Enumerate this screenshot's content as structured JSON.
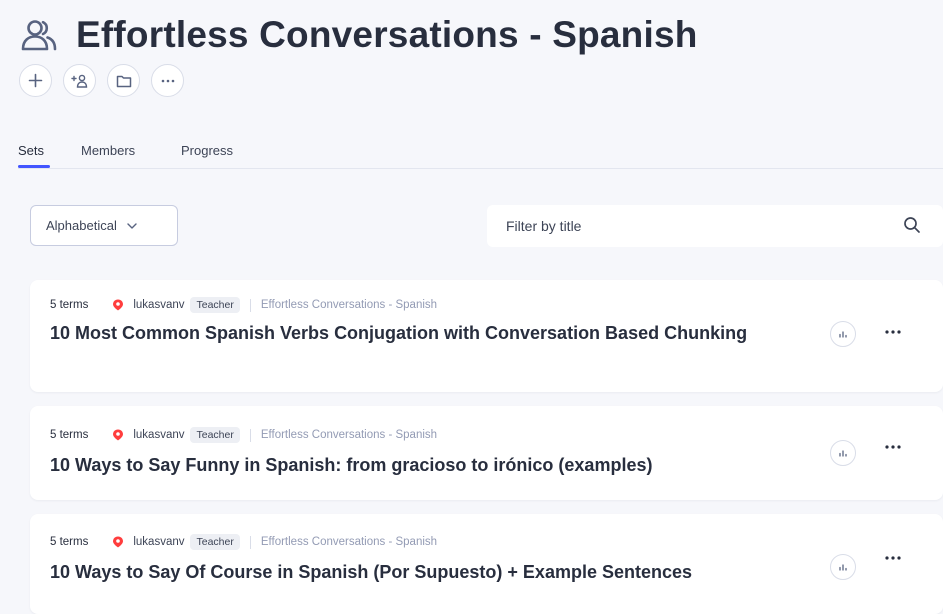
{
  "header": {
    "title": "Effortless Conversations - Spanish",
    "icon": "group-icon",
    "actions": [
      {
        "name": "add-icon"
      },
      {
        "name": "add-member-icon"
      },
      {
        "name": "folder-icon"
      },
      {
        "name": "more-icon"
      }
    ]
  },
  "tabs": [
    {
      "label": "Sets",
      "active": true
    },
    {
      "label": "Members",
      "active": false
    },
    {
      "label": "Progress",
      "active": false
    }
  ],
  "controls": {
    "sort_label": "Alphabetical",
    "filter_placeholder": "Filter by title"
  },
  "colors": {
    "accent": "#4255ff",
    "avatar": "#ff3d3d",
    "text": "#282e3e",
    "muted": "#939bb4"
  },
  "sets": [
    {
      "terms": "5 terms",
      "user": "lukasvanv",
      "badge": "Teacher",
      "folder": "Effortless Conversations - Spanish",
      "title": "10 Most Common Spanish Verbs Conjugation with Conversation Based Chunking"
    },
    {
      "terms": "5 terms",
      "user": "lukasvanv",
      "badge": "Teacher",
      "folder": "Effortless Conversations - Spanish",
      "title": "10 Ways to Say Funny in Spanish: from gracioso to irónico (examples)"
    },
    {
      "terms": "5 terms",
      "user": "lukasvanv",
      "badge": "Teacher",
      "folder": "Effortless Conversations - Spanish",
      "title": "10 Ways to Say Of Course in Spanish (Por Supuesto) + Example Sentences"
    }
  ]
}
